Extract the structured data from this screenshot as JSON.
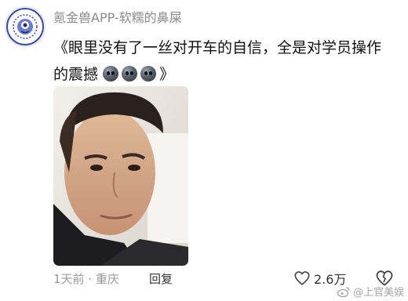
{
  "comment": {
    "username": "氪金兽APP-软糯的鼻屎",
    "text": "《眼里没有了一丝对开车的自信，全是对学员操作的震撼",
    "text_end": "》",
    "emoji": [
      "sad-face-emoji",
      "sad-face-emoji",
      "sad-face-emoji"
    ],
    "time_location": "1天前 · 重庆",
    "reply_label": "回复",
    "like_count": "2.6万"
  },
  "watermark": {
    "text": "@上官美娱"
  },
  "colors": {
    "username": "#8b8b8b",
    "text": "#111111",
    "meta": "#9a9a9a"
  }
}
